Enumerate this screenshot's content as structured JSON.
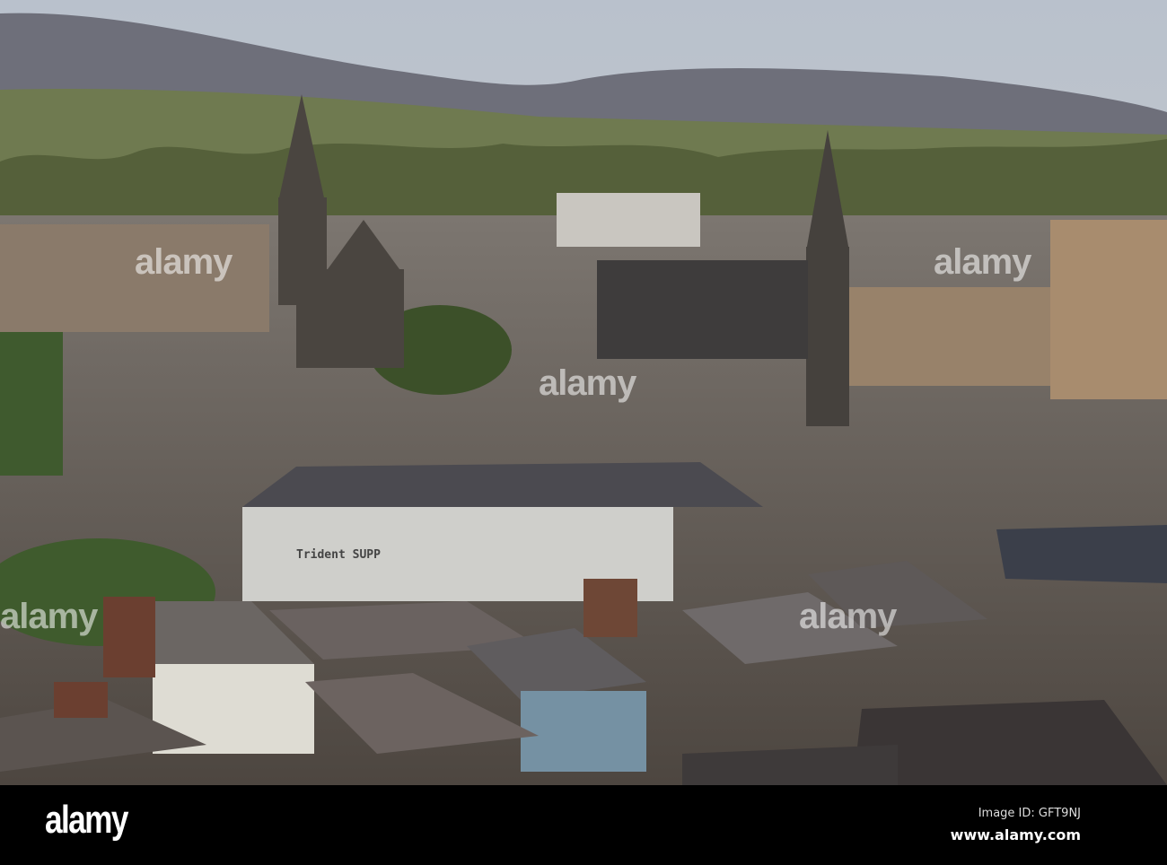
{
  "photo": {
    "sign_text": "Trident SUPP"
  },
  "watermark": {
    "text": "alamy"
  },
  "footer": {
    "logo": "alamy",
    "image_id": "Image ID: GFT9NJ",
    "website": "www.alamy.com"
  }
}
